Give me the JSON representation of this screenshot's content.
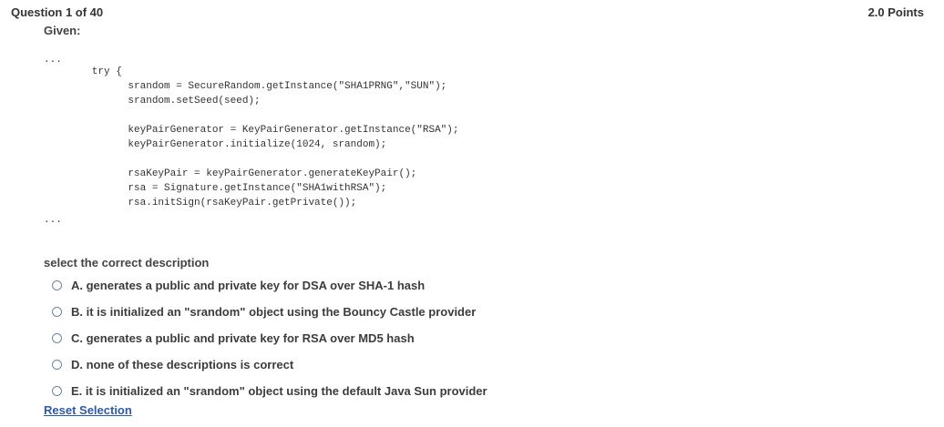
{
  "header": {
    "question_number": "Question 1 of 40",
    "points": "2.0 Points"
  },
  "question": {
    "given_label": "Given:",
    "code_lines": [
      "...",
      "        try {",
      "              srandom = SecureRandom.getInstance(\"SHA1PRNG\",\"SUN\");",
      "              srandom.setSeed(seed);",
      "              keyPairGenerator = KeyPairGenerator.getInstance(\"RSA\");",
      "              keyPairGenerator.initialize(1024, srandom);",
      "              rsaKeyPair = keyPairGenerator.generateKeyPair();",
      "              rsa = Signature.getInstance(\"SHA1withRSA\");",
      "              rsa.initSign(rsaKeyPair.getPrivate());",
      "..."
    ],
    "prompt": "select the correct description",
    "options": [
      "A. generates a public and private key for DSA over SHA-1 hash",
      "B. it is initialized an \"srandom\" object using the Bouncy Castle provider",
      "C. generates a public and private key for RSA over MD5 hash",
      "D. none of these descriptions is correct",
      "E. it is initialized an \"srandom\" object using the default Java Sun provider"
    ],
    "reset_label": "Reset Selection"
  }
}
